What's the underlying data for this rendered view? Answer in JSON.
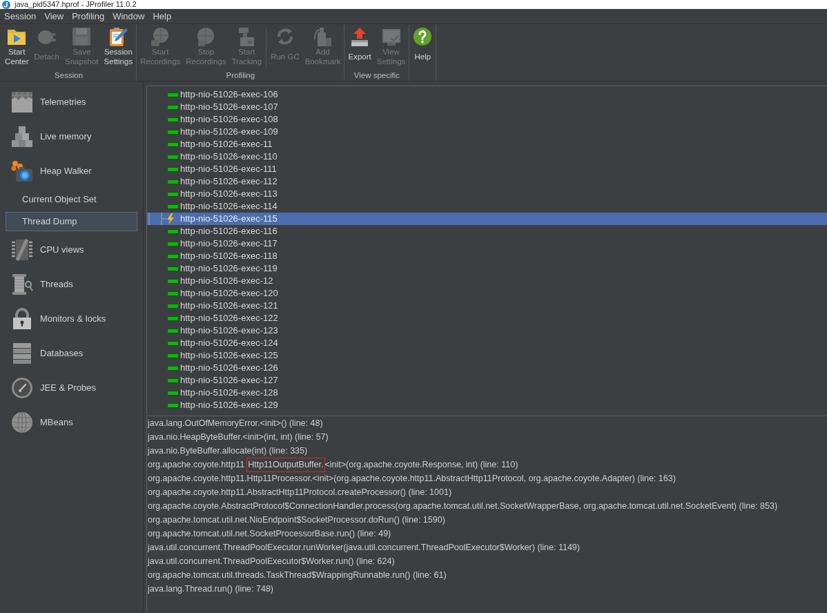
{
  "window": {
    "title": "java_pid5347.hprof - JProfiler 11.0.2"
  },
  "menu_bar": [
    {
      "label": "Session"
    },
    {
      "label": "View"
    },
    {
      "label": "Profiling"
    },
    {
      "label": "Window"
    },
    {
      "label": "Help"
    }
  ],
  "toolbar": [
    {
      "label": "Session",
      "sections": [
        [
          {
            "lines": [
              "Start",
              "Center"
            ],
            "disabled": false
          },
          {
            "lines": [
              "Detach"
            ],
            "disabled": true
          },
          {
            "lines": [
              "Save",
              "Snapshot"
            ],
            "disabled": true
          },
          {
            "lines": [
              "Session",
              "Settings"
            ],
            "disabled": false
          }
        ]
      ]
    },
    {
      "label": "Profiling",
      "sections": [
        [
          {
            "lines": [
              "Start",
              "Recordings"
            ],
            "disabled": true
          },
          {
            "lines": [
              "Stop",
              "Recordings"
            ],
            "disabled": true
          },
          {
            "lines": [
              "Start",
              "Tracking"
            ],
            "disabled": true
          }
        ],
        [
          {
            "lines": [
              "Run GC"
            ],
            "disabled": true
          },
          {
            "lines": [
              "Add",
              "Bookmark"
            ],
            "disabled": true
          }
        ]
      ]
    },
    {
      "label": "View specific",
      "sections": [
        [
          {
            "lines": [
              "Export"
            ],
            "disabled": false
          },
          {
            "lines": [
              "View",
              "Settings"
            ],
            "disabled": true
          }
        ]
      ]
    },
    {
      "sections": [
        [
          {
            "lines": [
              "Help"
            ],
            "disabled": false
          }
        ]
      ]
    }
  ],
  "sidebar": {
    "items": [
      {
        "label": "Telemetries",
        "selected": false
      },
      {
        "label": "Live memory",
        "selected": false
      },
      {
        "label": "Heap Walker",
        "selected": false,
        "children": [
          {
            "label": "Current Object Set",
            "selected": false
          },
          {
            "label": "Thread Dump",
            "selected": true
          }
        ]
      },
      {
        "label": "CPU views",
        "selected": false
      },
      {
        "label": "Threads",
        "selected": false
      },
      {
        "label": "Monitors & locks",
        "selected": false
      },
      {
        "label": "Databases",
        "selected": false
      },
      {
        "label": "JEE & Probes",
        "selected": false
      },
      {
        "label": "MBeans",
        "selected": false
      }
    ]
  },
  "threads": [
    {
      "name": "http-nio-51026-exec-106",
      "kind": "runnable",
      "selected": false
    },
    {
      "name": "http-nio-51026-exec-107",
      "kind": "runnable",
      "selected": false
    },
    {
      "name": "http-nio-51026-exec-108",
      "kind": "runnable",
      "selected": false
    },
    {
      "name": "http-nio-51026-exec-109",
      "kind": "runnable",
      "selected": false
    },
    {
      "name": "http-nio-51026-exec-11",
      "kind": "runnable",
      "selected": false
    },
    {
      "name": "http-nio-51026-exec-110",
      "kind": "runnable",
      "selected": false
    },
    {
      "name": "http-nio-51026-exec-111",
      "kind": "runnable",
      "selected": false
    },
    {
      "name": "http-nio-51026-exec-112",
      "kind": "runnable",
      "selected": false
    },
    {
      "name": "http-nio-51026-exec-113",
      "kind": "runnable",
      "selected": false
    },
    {
      "name": "http-nio-51026-exec-114",
      "kind": "runnable",
      "selected": false
    },
    {
      "name": "http-nio-51026-exec-115",
      "kind": "flagged",
      "selected": true
    },
    {
      "name": "http-nio-51026-exec-116",
      "kind": "runnable",
      "selected": false
    },
    {
      "name": "http-nio-51026-exec-117",
      "kind": "runnable",
      "selected": false
    },
    {
      "name": "http-nio-51026-exec-118",
      "kind": "runnable",
      "selected": false
    },
    {
      "name": "http-nio-51026-exec-119",
      "kind": "runnable",
      "selected": false
    },
    {
      "name": "http-nio-51026-exec-12",
      "kind": "runnable",
      "selected": false
    },
    {
      "name": "http-nio-51026-exec-120",
      "kind": "runnable",
      "selected": false
    },
    {
      "name": "http-nio-51026-exec-121",
      "kind": "runnable",
      "selected": false
    },
    {
      "name": "http-nio-51026-exec-122",
      "kind": "runnable",
      "selected": false
    },
    {
      "name": "http-nio-51026-exec-123",
      "kind": "runnable",
      "selected": false
    },
    {
      "name": "http-nio-51026-exec-124",
      "kind": "runnable",
      "selected": false
    },
    {
      "name": "http-nio-51026-exec-125",
      "kind": "runnable",
      "selected": false
    },
    {
      "name": "http-nio-51026-exec-126",
      "kind": "runnable",
      "selected": false
    },
    {
      "name": "http-nio-51026-exec-127",
      "kind": "runnable",
      "selected": false
    },
    {
      "name": "http-nio-51026-exec-128",
      "kind": "runnable",
      "selected": false
    },
    {
      "name": "http-nio-51026-exec-129",
      "kind": "runnable",
      "selected": false
    }
  ],
  "stack_trace": [
    {
      "kind": "plain",
      "text": "java.lang.OutOfMemoryError.<init>() (line: 48)"
    },
    {
      "kind": "plain",
      "text": "java.nio.HeapByteBuffer.<init>(int, int) (line: 57)"
    },
    {
      "kind": "plain",
      "text": "java.nio.ByteBuffer.allocate(int) (line: 335)"
    },
    {
      "kind": "marked",
      "before": "org.apache.coyote.http11",
      "marked": "Http11OutputBuffer.",
      "after": "<init>(org.apache.coyote.Response, int) (line: 110)"
    },
    {
      "kind": "plain",
      "text": "org.apache.coyote.http11.Http11Processor.<init>(org.apache.coyote.http11.AbstractHttp11Protocol, org.apache.coyote.Adapter) (line: 163)"
    },
    {
      "kind": "plain",
      "text": "org.apache.coyote.http11.AbstractHttp11Protocol.createProcessor() (line: 1001)"
    },
    {
      "kind": "plain",
      "text": "org.apache.coyote.AbstractProtocol$ConnectionHandler.process(org.apache.tomcat.util.net.SocketWrapperBase, org.apache.tomcat.util.net.SocketEvent) (line: 853)"
    },
    {
      "kind": "plain",
      "text": "org.apache.tomcat.util.net.NioEndpoint$SocketProcessor.doRun() (line: 1590)"
    },
    {
      "kind": "plain",
      "text": "org.apache.tomcat.util.net.SocketProcessorBase.run() (line: 49)"
    },
    {
      "kind": "plain",
      "text": "java.util.concurrent.ThreadPoolExecutor.runWorker(java.util.concurrent.ThreadPoolExecutor$Worker) (line: 1149)"
    },
    {
      "kind": "plain",
      "text": "java.util.concurrent.ThreadPoolExecutor$Worker.run() (line: 624)"
    },
    {
      "kind": "plain",
      "text": "org.apache.tomcat.util.threads.TaskThread$WrappingRunnable.run() (line: 61)"
    },
    {
      "kind": "plain",
      "text": "java.lang.Thread.run() (line: 748)"
    }
  ]
}
